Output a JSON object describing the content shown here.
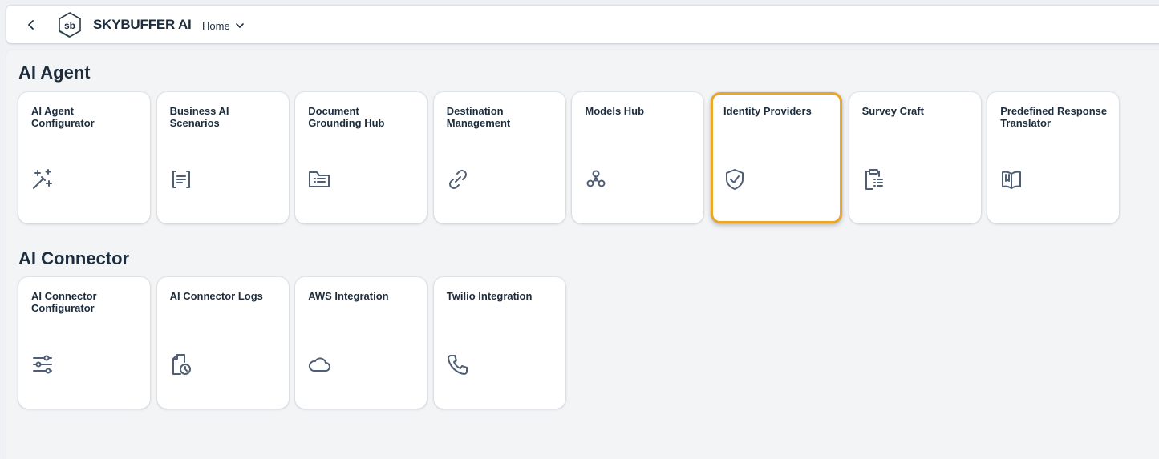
{
  "header": {
    "brand": "SKYBUFFER AI",
    "logo_text": "sb",
    "nav_label": "Home"
  },
  "sections": [
    {
      "title": "AI Agent",
      "tiles": [
        {
          "title": "AI Agent\nConfigurator",
          "icon": "magic-wand-icon"
        },
        {
          "title": "Business AI\nScenarios",
          "icon": "document-bracket-icon"
        },
        {
          "title": "Document\nGrounding Hub",
          "icon": "folder-list-icon"
        },
        {
          "title": "Destination\nManagement",
          "icon": "link-icon"
        },
        {
          "title": "Models Hub",
          "icon": "network-nodes-icon"
        },
        {
          "title": "Identity Providers",
          "icon": "shield-check-icon",
          "focused": true
        },
        {
          "title": "Survey Craft",
          "icon": "clipboard-list-icon"
        },
        {
          "title": "Predefined Response\nTranslator",
          "icon": "open-book-icon"
        }
      ]
    },
    {
      "title": "AI Connector",
      "tiles": [
        {
          "title": "AI Connector\nConfigurator",
          "icon": "sliders-icon"
        },
        {
          "title": "AI Connector Logs",
          "icon": "log-clock-icon"
        },
        {
          "title": "AWS Integration",
          "icon": "cloud-icon"
        },
        {
          "title": "Twilio Integration",
          "icon": "phone-icon"
        }
      ]
    }
  ],
  "colors": {
    "focus": "#eaa625",
    "icon": "#4f5e74",
    "text": "#1d2d3e",
    "background": "#f3f4f6"
  }
}
